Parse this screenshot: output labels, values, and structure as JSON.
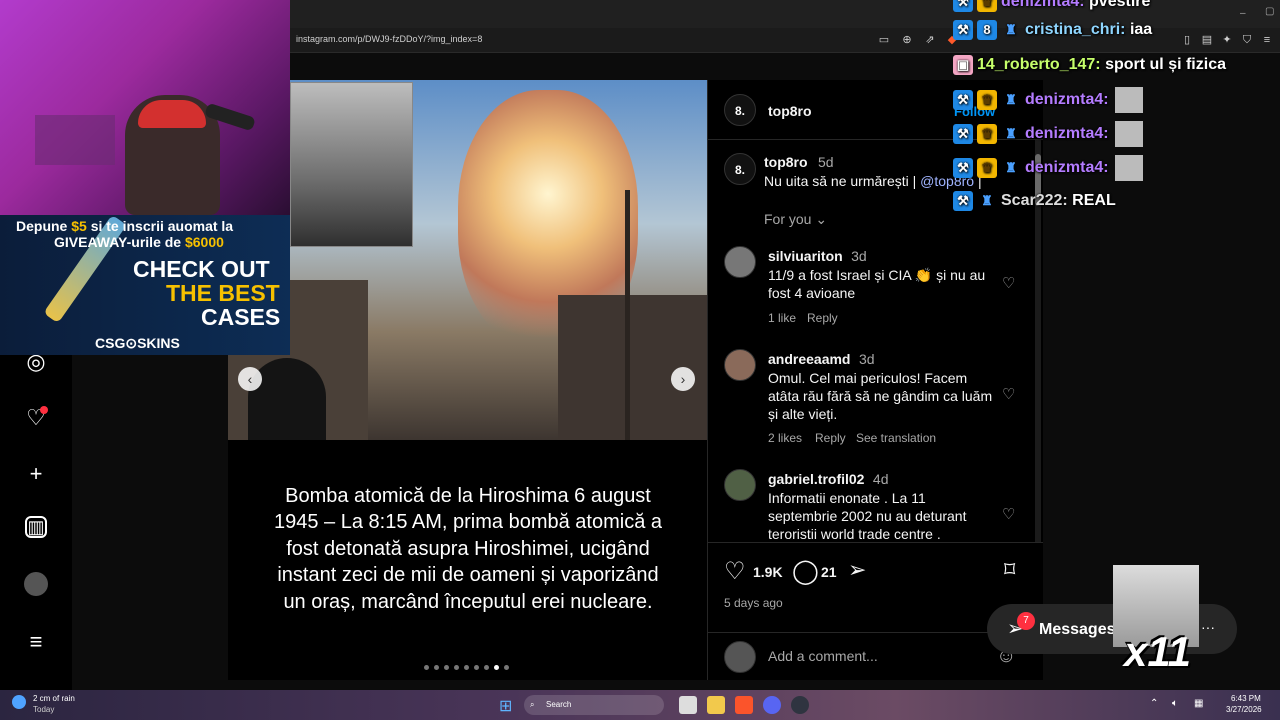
{
  "browser": {
    "url": "instagram.com/p/DWJ9-fzDDoY/?img_index=8"
  },
  "ad": {
    "line1_prefix": "Depune ",
    "line1_amount": "$5",
    "line1_suffix": " si te inscrii auomat la",
    "line2_prefix": "GIVEAWAY-urile de ",
    "line2_amount": "$6000",
    "check": "CHECK OUT",
    "best": "THE BEST",
    "cases": "CASES",
    "logo": "CSG⊙SKINS"
  },
  "post": {
    "caption_image_text": "Bomba atomică de la Hiroshima 6 august 1945 – La 8:15 AM, prima bombă atomică a fost detonată asupra Hiroshimei, ucigând instant zeci de mii de oameni și vaporizând un oraș, marcând începutul erei nucleare.",
    "author": "top8ro",
    "author_avatar": "8.",
    "follow_label": "Follow",
    "caption_time": "5d",
    "caption_text": "Nu uita să ne urmărești |",
    "caption_mention": "@top8ro",
    "caption_tail": "|",
    "for_you_label": "For you",
    "likes": "1.9K",
    "comments_count": "21",
    "date": "5 days ago",
    "add_comment_placeholder": "Add a comment...",
    "carousel_count": 9,
    "carousel_active": 7
  },
  "comments": [
    {
      "user": "silviuariton",
      "time": "3d",
      "text": "11/9 a fost Israel și CIA 👏 și nu au fost 4 avioane",
      "likes": "1 like",
      "reply": "Reply",
      "translate": ""
    },
    {
      "user": "andreeaamd",
      "time": "3d",
      "text": "Omul. Cel mai periculos! Facem atâta rău fără să ne gândim ca luăm și alte vieți.",
      "likes": "2 likes",
      "reply": "Reply",
      "translate": "See translation"
    },
    {
      "user": "gabriel.trofil02",
      "time": "4d",
      "text": "Informatii enonate . La 11 septembrie 2002 nu au deturant teroristii world trade centre .",
      "likes": "",
      "reply": "",
      "translate": ""
    }
  ],
  "chat": [
    {
      "user": "denizmta4:",
      "text": "pvestire",
      "color": "#b47cff"
    },
    {
      "user": "cristina_chri:",
      "text": "iaa",
      "color": "#8fd6ff"
    },
    {
      "user": "14_roberto_147:",
      "text": "sport ul și fizica",
      "color": "#c6ff6b"
    },
    {
      "user": "denizmta4:",
      "text": "",
      "color": "#b47cff"
    },
    {
      "user": "denizmta4:",
      "text": "",
      "color": "#b47cff"
    },
    {
      "user": "denizmta4:",
      "text": "",
      "color": "#b47cff"
    },
    {
      "user": "Scar222:",
      "text": "REAL",
      "color": "#dddddd"
    }
  ],
  "messages": {
    "label": "Messages",
    "badge": "7",
    "multiplier": "x11"
  },
  "taskbar": {
    "weather": "2 cm of rain",
    "weather_sub": "Today",
    "search": "Search",
    "time": "6:43 PM",
    "date": "3/27/2026"
  },
  "colors": {
    "accent_link": "#a0b4ff",
    "heart_badge": "#ff3040"
  }
}
